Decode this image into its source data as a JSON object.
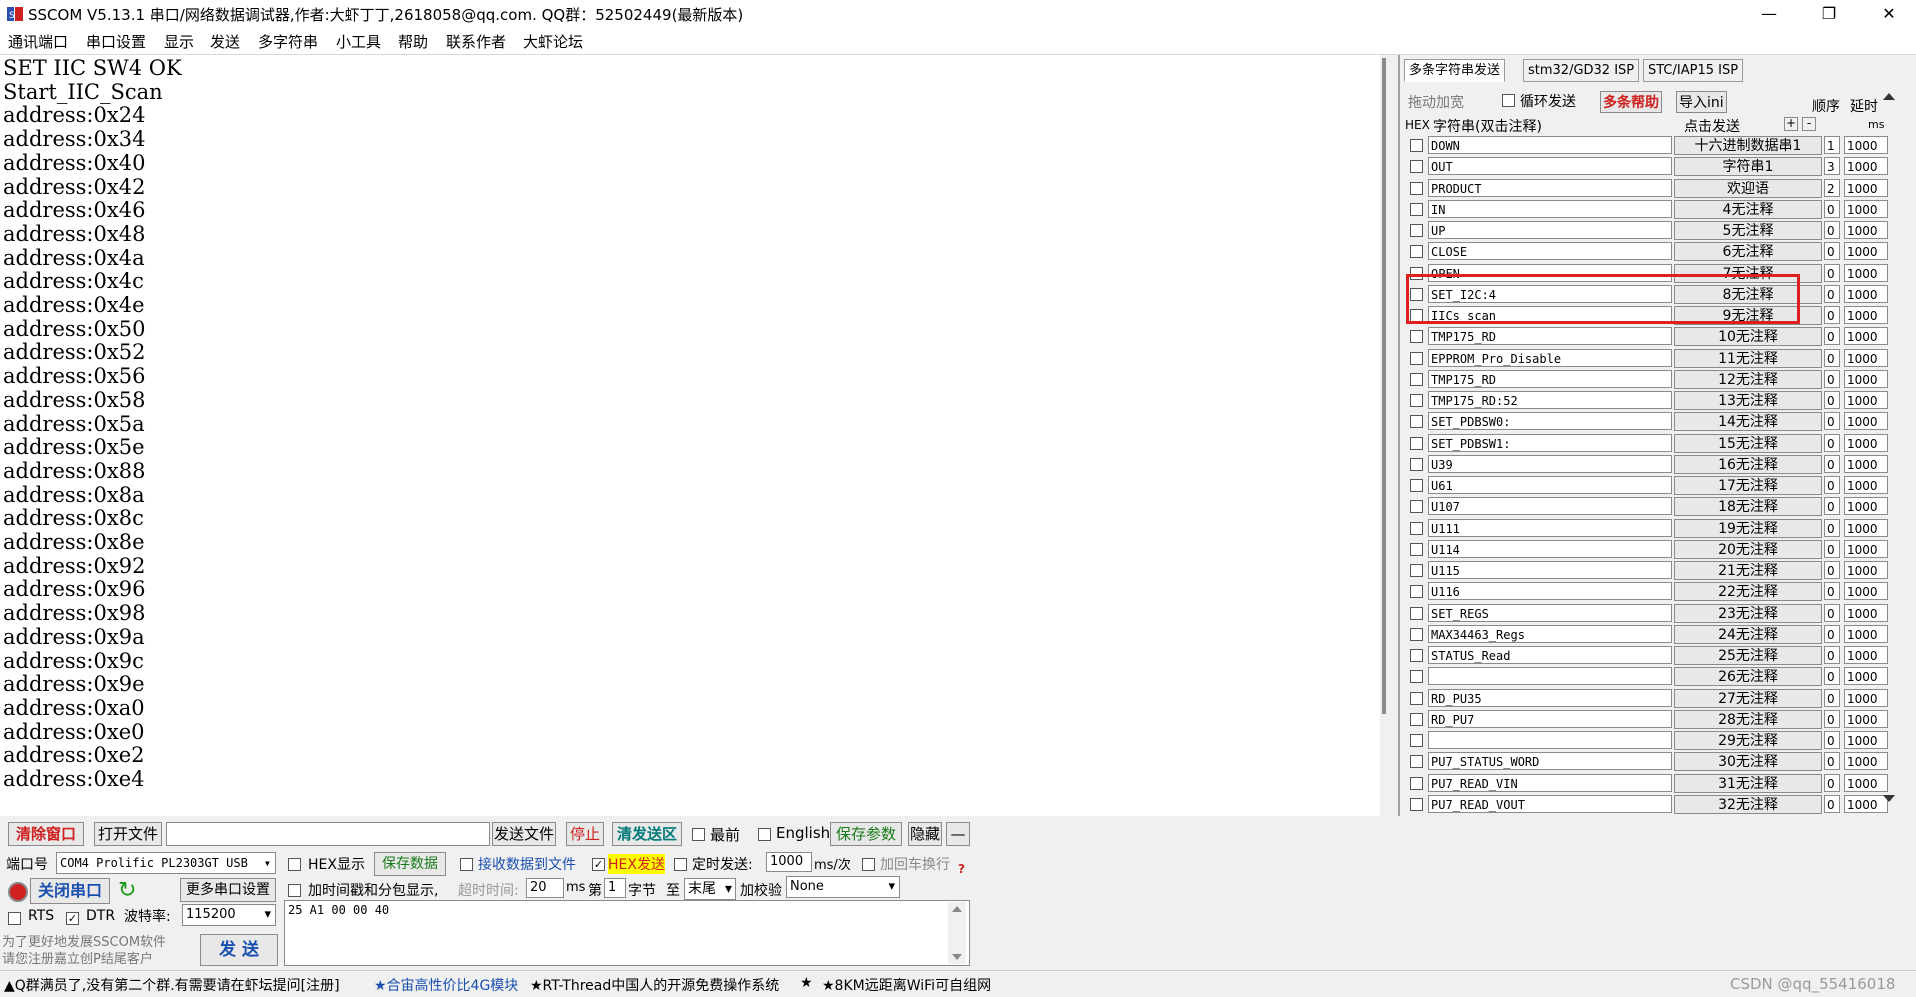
{
  "window": {
    "title": "SSCOM V5.13.1 串口/网络数据调试器,作者:大虾丁丁,2618058@qq.com. QQ群：52502449(最新版本)",
    "minimize": "—",
    "maximize": "❐",
    "close": "✕"
  },
  "menu": [
    "通讯端口",
    "串口设置",
    "显示",
    "发送",
    "多字符串",
    "小工具",
    "帮助",
    "联系作者",
    "大虾论坛"
  ],
  "receive": {
    "lines": "SET IIC SW4 OK\nStart_IIC_Scan\naddress:0x24\naddress:0x34\naddress:0x40\naddress:0x42\naddress:0x46\naddress:0x48\naddress:0x4a\naddress:0x4c\naddress:0x4e\naddress:0x50\naddress:0x52\naddress:0x56\naddress:0x58\naddress:0x5a\naddress:0x5e\naddress:0x88\naddress:0x8a\naddress:0x8c\naddress:0x8e\naddress:0x92\naddress:0x96\naddress:0x98\naddress:0x9a\naddress:0x9c\naddress:0x9e\naddress:0xa0\naddress:0xe0\naddress:0xe2\naddress:0xe4"
  },
  "right_panel": {
    "tabs": [
      "多条字符串发送",
      "stm32/GD32 ISP",
      "STC/IAP15 ISP"
    ],
    "drag_label": "拖动加宽",
    "loop_label": "循环发送",
    "help_label": "多条帮助",
    "import_label": "导入ini",
    "order_label": "顺序",
    "delay_label": "延时",
    "hex_col": "HEX",
    "str_col": "字符串(双击注释)",
    "click_col": "点击发送",
    "plus": "+",
    "minus": "-",
    "ms_col": "ms",
    "rows": [
      {
        "name": "DOWN",
        "btn": "十六进制数据串1",
        "ord": "1",
        "delay": "1000"
      },
      {
        "name": "OUT",
        "btn": "字符串1",
        "ord": "3",
        "delay": "1000"
      },
      {
        "name": "PRODUCT",
        "btn": "欢迎语",
        "ord": "2",
        "delay": "1000"
      },
      {
        "name": "IN",
        "btn": "4无注释",
        "ord": "0",
        "delay": "1000"
      },
      {
        "name": "UP",
        "btn": "5无注释",
        "ord": "0",
        "delay": "1000"
      },
      {
        "name": "CLOSE",
        "btn": "6无注释",
        "ord": "0",
        "delay": "1000"
      },
      {
        "name": "OPEN",
        "btn": "7无注释",
        "ord": "0",
        "delay": "1000"
      },
      {
        "name": "SET_I2C:4",
        "btn": "8无注释",
        "ord": "0",
        "delay": "1000"
      },
      {
        "name": "IICs_scan",
        "btn": "9无注释",
        "ord": "0",
        "delay": "1000"
      },
      {
        "name": "TMP175_RD",
        "btn": "10无注释",
        "ord": "0",
        "delay": "1000"
      },
      {
        "name": "EPPROM_Pro_Disable",
        "btn": "11无注释",
        "ord": "0",
        "delay": "1000"
      },
      {
        "name": "TMP175_RD",
        "btn": "12无注释",
        "ord": "0",
        "delay": "1000"
      },
      {
        "name": "TMP175_RD:52",
        "btn": "13无注释",
        "ord": "0",
        "delay": "1000"
      },
      {
        "name": "SET_PDBSW0:",
        "btn": "14无注释",
        "ord": "0",
        "delay": "1000"
      },
      {
        "name": "SET_PDBSW1:",
        "btn": "15无注释",
        "ord": "0",
        "delay": "1000"
      },
      {
        "name": "U39",
        "btn": "16无注释",
        "ord": "0",
        "delay": "1000"
      },
      {
        "name": "U61",
        "btn": "17无注释",
        "ord": "0",
        "delay": "1000"
      },
      {
        "name": "U107",
        "btn": "18无注释",
        "ord": "0",
        "delay": "1000"
      },
      {
        "name": "U111",
        "btn": "19无注释",
        "ord": "0",
        "delay": "1000"
      },
      {
        "name": "U114",
        "btn": "20无注释",
        "ord": "0",
        "delay": "1000"
      },
      {
        "name": "U115",
        "btn": "21无注释",
        "ord": "0",
        "delay": "1000"
      },
      {
        "name": "U116",
        "btn": "22无注释",
        "ord": "0",
        "delay": "1000"
      },
      {
        "name": "SET_REGS",
        "btn": "23无注释",
        "ord": "0",
        "delay": "1000"
      },
      {
        "name": "MAX34463_Regs",
        "btn": "24无注释",
        "ord": "0",
        "delay": "1000"
      },
      {
        "name": "STATUS_Read",
        "btn": "25无注释",
        "ord": "0",
        "delay": "1000"
      },
      {
        "name": "",
        "btn": "26无注释",
        "ord": "0",
        "delay": "1000"
      },
      {
        "name": "RD_PU35",
        "btn": "27无注释",
        "ord": "0",
        "delay": "1000"
      },
      {
        "name": "RD_PU7",
        "btn": "28无注释",
        "ord": "0",
        "delay": "1000"
      },
      {
        "name": "",
        "btn": "29无注释",
        "ord": "0",
        "delay": "1000"
      },
      {
        "name": "PU7_STATUS_WORD",
        "btn": "30无注释",
        "ord": "0",
        "delay": "1000"
      },
      {
        "name": "PU7_READ_VIN",
        "btn": "31无注释",
        "ord": "0",
        "delay": "1000"
      },
      {
        "name": "PU7_READ_VOUT",
        "btn": "32无注释",
        "ord": "0",
        "delay": "1000"
      }
    ]
  },
  "toolbar": {
    "clear": "清除窗口",
    "open_file": "打开文件",
    "send_file": "发送文件",
    "stop": "停止",
    "clear_send": "清发送区",
    "latest": "最前",
    "english": "English",
    "save_params": "保存参数",
    "hide": "隐藏",
    "dash": "—"
  },
  "port": {
    "port_label": "端口号",
    "port_value": "COM4 Prolific PL2303GT USB",
    "close_port": "关闭串口",
    "more_settings": "更多串口设置",
    "rts": "RTS",
    "dtr": "DTR",
    "baud_label": "波特率:",
    "baud_value": "115200",
    "promo": "为了更好地发展SSCOM软件\n请您注册嘉立创P结尾客户",
    "send": "发 送"
  },
  "options": {
    "hex_display": "HEX显示",
    "save_data": "保存数据",
    "recv_to_file": "接收数据到文件",
    "hex_send": "HEX发送",
    "timed_send": "定时发送:",
    "timed_value": "1000",
    "ms_per": "ms/次",
    "add_newline": "加回车换行",
    "timestamp": "加时间戳和分包显示,",
    "timeout_label": "超时时间:",
    "timeout_value": "20",
    "ms": "ms",
    "nth": "第",
    "byte_value": "1",
    "byte": "字节",
    "to": "至",
    "end": "末尾",
    "checksum": "加校验",
    "checksum_value": "None",
    "send_data": "25 A1 00 00 40",
    "help_q": "?"
  },
  "status": {
    "text1": "▲Q群满员了,没有第二个群.有需要请在虾坛提问[注册]",
    "text2": "★合宙高性价比4G模块",
    "text3": "★RT-Thread中国人的开源免费操作系统",
    "text4": "★",
    "text5": "★8KM远距离WiFi可自组网",
    "watermark": "CSDN @qq_55416018"
  }
}
